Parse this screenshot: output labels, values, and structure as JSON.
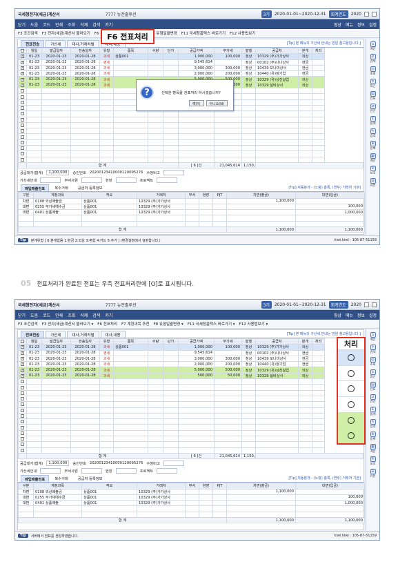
{
  "window": {
    "title": "국세청전자(세금)계산서",
    "center": "7777 뉴전출루션",
    "period_badge": "3기",
    "period": "2020-01-01~2020-12-31",
    "year_badge": "회계연도",
    "year": "2020",
    "slot_badge": "회계연도",
    "slot": "2020"
  },
  "toolbar": {
    "items": [
      "닫기",
      "도움",
      "코드",
      "인쇄",
      "조회",
      "삭제",
      "검색",
      "카기"
    ],
    "right_items": [
      "영상",
      "메뉴",
      "정보",
      "설정"
    ]
  },
  "funcbar": {
    "items": [
      "F3 조건검색",
      "F3 전자(세금)계산서 불러오기",
      "F6 전표처리",
      "F7 계정과목 추천",
      "F8 유형일괄변경",
      "F11 국세청홈택스 바로가기",
      "F12 사용법보기"
    ],
    "items2": [
      "F3 조건검색",
      "F3 전자(세금)계산서 불러오기 ▾",
      "F6 전표처리",
      "F7 계정과목 추천",
      "F8 유형일괄변경 ▾",
      "F11 국세청홈택스 바로가기 ▾",
      "F12 사용법보기 ▾"
    ]
  },
  "callout_f6": "F6 전표처리",
  "main_tabs": [
    "전표전송",
    "가산세",
    "대사,거래처별",
    "대사,내용"
  ],
  "tip_top": "[Tip] 본 메뉴의 가산세 안내는 만원 참고용입니다.]",
  "columns": [
    "월일",
    "발급일자",
    "전송일자",
    "유형",
    "품목",
    "수량",
    "단가",
    "공급가액",
    "부가세",
    "발행",
    "공급처",
    "분개",
    "처리"
  ],
  "rows": [
    {
      "day": "01-23",
      "issue": "2020-01-23",
      "sent": "2020-01-28",
      "type": "과세",
      "item": "상품001",
      "qty": "",
      "price": "",
      "supply": "1,000,000",
      "vat": "100,000",
      "issued": "정상",
      "vendor": "10329 (주)가가상사",
      "journal": "외상",
      "style": "sel",
      "checked": true
    },
    {
      "day": "01-23",
      "issue": "2020-01-23",
      "sent": "2020-01-28",
      "type": "영세",
      "item": "",
      "qty": "",
      "price": "",
      "supply": "9,545,614",
      "vat": "",
      "issued": "정상",
      "vendor": "00102 (주)나나상사",
      "journal": "현금",
      "style": "",
      "checked": true
    },
    {
      "day": "01-23",
      "issue": "2020-01-23",
      "sent": "2020-01-28",
      "type": "과세",
      "item": "",
      "qty": "",
      "price": "",
      "supply": "3,000,000",
      "vat": "300,000",
      "issued": "정상",
      "vendor": "10439 모나미상사",
      "journal": "현금",
      "style": "",
      "checked": true
    },
    {
      "day": "01-23",
      "issue": "2020-01-23",
      "sent": "2020-01-28",
      "type": "과세",
      "item": "",
      "qty": "",
      "price": "",
      "supply": "2,000,000",
      "vat": "200,000",
      "issued": "정상",
      "vendor": "10440 (유)정기업",
      "journal": "현금",
      "style": "",
      "checked": true
    },
    {
      "day": "01-23",
      "issue": "2020-01-23",
      "sent": "2020-01-28",
      "type": "과세",
      "item": "",
      "qty": "",
      "price": "",
      "supply": "5,000,000",
      "vat": "500,000",
      "issued": "정상",
      "vendor": "10329 (유)상진실업",
      "journal": "외상",
      "style": "green",
      "checked": true
    },
    {
      "day": "01-23",
      "issue": "2020-01-23",
      "sent": "2020-01-28",
      "type": "과세",
      "item": "",
      "qty": "",
      "price": "",
      "supply": "500,000",
      "vat": "50,000",
      "issued": "정상",
      "vendor": "10329 설비상사",
      "journal": "외상",
      "style": "green",
      "checked": true
    }
  ],
  "empty_rows": 13,
  "total": {
    "label": "합 계",
    "count": "[ 6 ]건",
    "supply": "21,045,614",
    "vat": "1,150,000"
  },
  "info": {
    "supply_label": "공급대가(합계)",
    "supply_value": "1,100,000",
    "approval_label": "승인번호",
    "approval_value": "20200123410000120095276",
    "edit_label": "수정비고",
    "tax_label": "가산세안내",
    "dept_label": "부서사원",
    "site_label": "현장",
    "project_label": "프로젝트"
  },
  "sub_tabs": [
    "매입매출전표",
    "복수거래",
    "공급처 등록정보"
  ],
  "sub_tip": "[Tip] 자동분개 - (노랑) 흥록, (연두) 거래처 기본]",
  "sub_columns": [
    "구분",
    "계정과목",
    "적요",
    "거래처",
    "부서",
    "현장",
    "PJT",
    "차변(출금)",
    "대변(입금)"
  ],
  "sub_rows": [
    {
      "kind": "차변",
      "account": "0108 외상매출금",
      "memo": "상품001",
      "vendor": "10329 (주)가가상사",
      "debit": "1,100,000",
      "credit": ""
    },
    {
      "kind": "대변",
      "account": "0255 부가세예수금",
      "memo": "상품001",
      "vendor": "10329 (주)가가상사",
      "debit": "",
      "credit": "100,000"
    },
    {
      "kind": "대변",
      "account": "0401 상품매출",
      "memo": "상품001",
      "vendor": "10329 (주)가가상사",
      "debit": "",
      "credit": "1,000,000"
    }
  ],
  "sub_total": {
    "label": "합 계",
    "debit": "1,100,000",
    "credit": "1,100,000"
  },
  "status": {
    "tip": "Tip",
    "msg1": "분개유형 [ 0:분개없음 1:현금 2:외상 3:혼합 4:카드 5:추가 ] (환경설정에서 설정합니다.)",
    "msg2": "서버에서 전표를 생성하였습니다.",
    "user": "kiwi.kiwi : 105-87-51159"
  },
  "dialog": {
    "message": "선택한 항목을 전표처리 하시겠습니까?",
    "yes": "예(Y)",
    "no": "아니오(N)"
  },
  "caption": {
    "num": "05",
    "text": "전표처리가 완료된 전표는 우측 전표처리란에 [O]로 표시됩니다."
  },
  "process_header": "처리",
  "rightbar": [
    "메인",
    "검색",
    "조회",
    "최근",
    "전표",
    "연간",
    "합계",
    "입력",
    "등록",
    "계산",
    "보호",
    "커뮤"
  ]
}
